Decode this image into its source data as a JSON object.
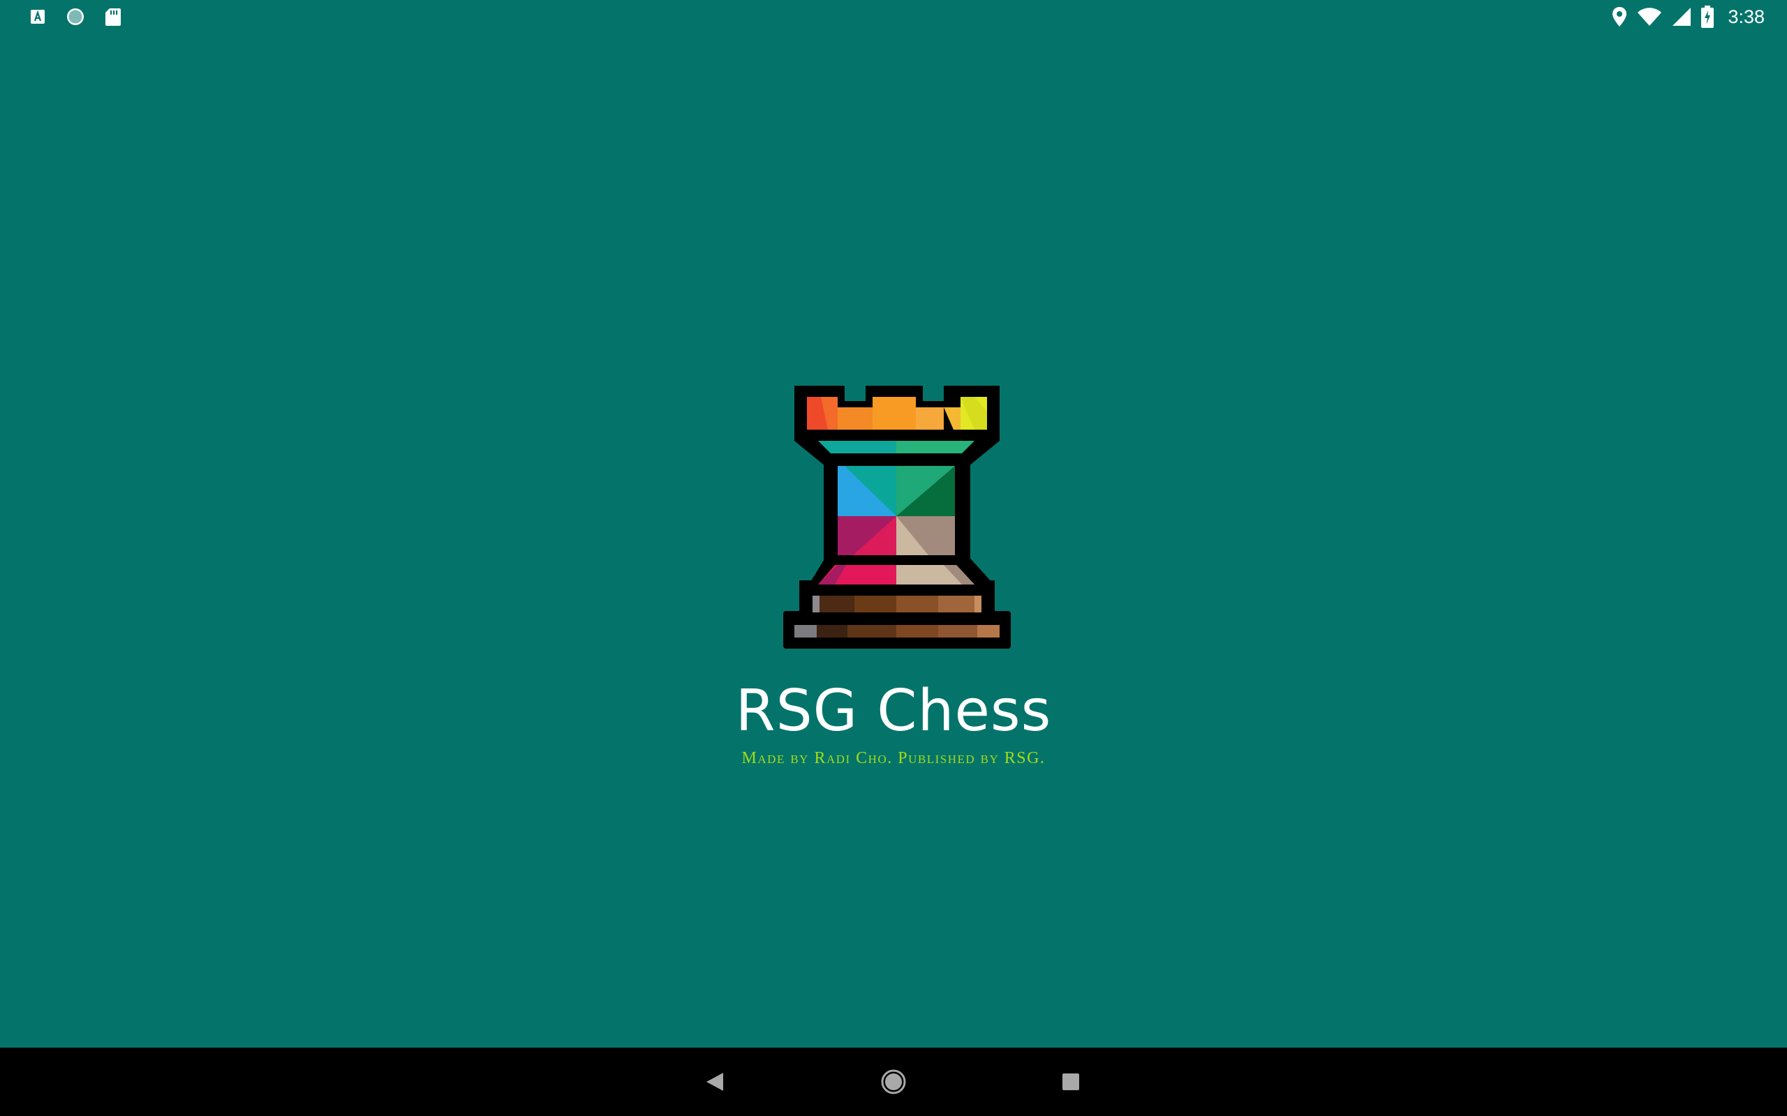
{
  "status_bar": {
    "left_icons": [
      "keyboard-a-icon",
      "sync-circle-icon",
      "sd-card-icon"
    ],
    "right_icons": [
      "location-pin-icon",
      "wifi-icon",
      "cell-signal-icon",
      "battery-charging-icon"
    ],
    "time": "3:38"
  },
  "splash": {
    "logo_icon": "rook-chess-logo-icon",
    "title": "RSG Chess",
    "credits": "Made by Radi Cho. Published by RSG."
  },
  "navigation_bar": {
    "buttons": [
      "back-icon",
      "home-icon",
      "recents-icon"
    ]
  },
  "colors": {
    "background": "#04746b",
    "title": "#ffffff",
    "credits": "#a3dc17",
    "nav_bar": "#000000"
  }
}
